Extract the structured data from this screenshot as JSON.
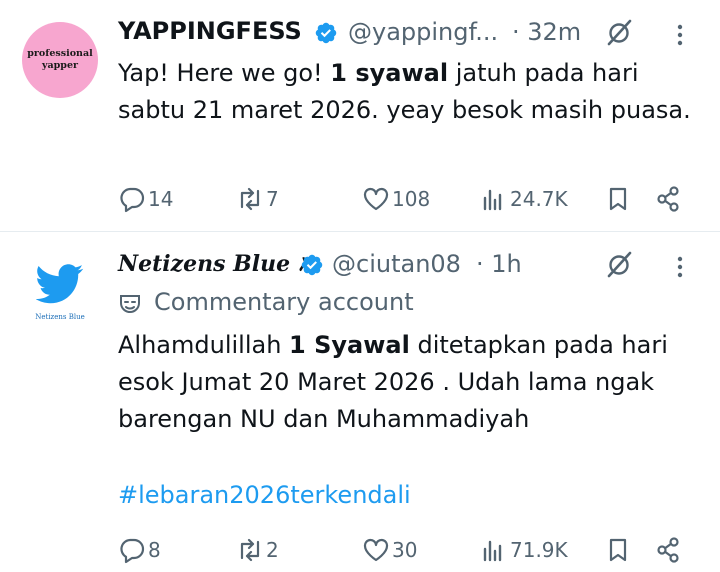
{
  "tweets": [
    {
      "avatar": {
        "line1": "professional",
        "line2": "yapper"
      },
      "name": "YAPPINGFESS",
      "handle": "@yappingf...",
      "time": "· 32m",
      "text_before": "Yap! Here we go! ",
      "text_bold": "1 syawal",
      "text_after": " jatuh pada hari sabtu 21 maret 2026. yeay besok masih puasa.",
      "replies": "14",
      "reposts": "7",
      "likes": "108",
      "views": "24.7K"
    },
    {
      "avatar": {
        "caption": "Netizens Blue"
      },
      "name": "Netizens Blue",
      "handle": "@ciutan08",
      "time": "· 1h",
      "label": "Commentary account",
      "text_before": "Alhamdulillah ",
      "text_bold": "1 Syawal",
      "text_after": " ditetapkan pada hari esok Jumat 20 Maret 2026 . Udah lama ngak barengan NU dan Muhammadiyah",
      "hashtag": "#lebaran2026terkendali",
      "replies": "8",
      "reposts": "2",
      "likes": "30",
      "views": "71.9K"
    }
  ],
  "colors": {
    "accent": "#1d9bf0",
    "secondary_text": "#536471",
    "verified": "#1d9bf0",
    "avatar1_bg": "#f7a6cf"
  },
  "icons": [
    "verified-badge-icon",
    "grok-icon",
    "more-icon",
    "reply-icon",
    "repost-icon",
    "like-icon",
    "views-icon",
    "bookmark-icon",
    "share-icon",
    "commentary-label-icon"
  ]
}
